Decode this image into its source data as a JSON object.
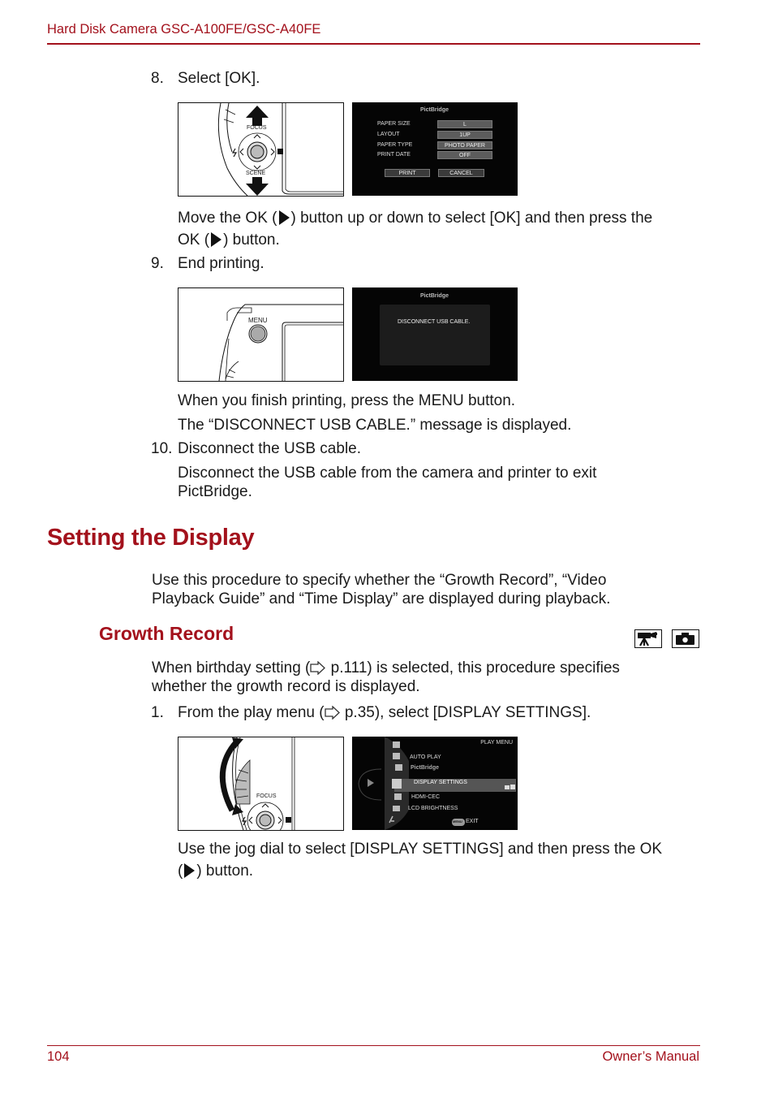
{
  "header": {
    "title": "Hard Disk Camera GSC-A100FE/GSC-A40FE",
    "accent_color": "#a3111c"
  },
  "steps": {
    "step8": {
      "number": "8.",
      "text": "Select [OK].",
      "desc_part1": "Move the OK (",
      "desc_part2": ") button up or down to select [OK] and then press the",
      "desc_part3": "OK (",
      "desc_part4": ") button."
    },
    "step9": {
      "number": "9.",
      "text": "End printing.",
      "desc1": "When you finish printing, press the MENU button.",
      "desc2": "The “DISCONNECT USB CABLE.” message is displayed."
    },
    "step10": {
      "number": "10.",
      "text": "Disconnect the USB cable.",
      "desc_line1": "Disconnect the USB cable from the camera and printer to exit",
      "desc_line2": "PictBridge."
    },
    "step1": {
      "number": "1.",
      "text_part1": "From the play menu (",
      "text_part2": " p.35), select [DISPLAY SETTINGS].",
      "desc_part1": "Use the jog dial to select [DISPLAY SETTINGS] and then press the OK",
      "desc_part2": "(",
      "desc_part3": ") button."
    }
  },
  "figures": {
    "fig1_camera": {
      "label_focus": "FOCUS",
      "label_scene": "SCENE"
    },
    "fig1_screen": {
      "title": "PictBridge",
      "rows": [
        {
          "label": "PAPER SIZE",
          "value": "L"
        },
        {
          "label": "LAYOUT",
          "value": "1UP"
        },
        {
          "label": "PAPER TYPE",
          "value": "PHOTO PAPER"
        },
        {
          "label": "PRINT DATE",
          "value": "OFF"
        }
      ],
      "print_button": "PRINT",
      "cancel_button": "CANCEL"
    },
    "fig2_camera": {
      "label_menu": "MENU"
    },
    "fig2_screen": {
      "title": "PictBridge",
      "message": "DISCONNECT USB CABLE."
    },
    "fig3_camera": {
      "label_focus": "FOCUS"
    },
    "fig3_screen": {
      "header": "PLAY MENU",
      "items": [
        "AUTO PLAY",
        "PictBridge",
        "DISPLAY SETTINGS",
        "HDMI-CEC",
        "LCD BRIGHTNESS"
      ],
      "selected_item": "DISPLAY SETTINGS",
      "menu_badge": "MENU",
      "exit_label": "EXIT"
    }
  },
  "section": {
    "title": "Setting the Display",
    "intro_line1": "Use this procedure to specify whether the “Growth Record”, “Video",
    "intro_line2": "Playback Guide” and “Time Display” are displayed during playback.",
    "subsection": {
      "title": "Growth Record",
      "mode_icons": [
        "video-camera-icon",
        "still-camera-icon"
      ],
      "body_part1": "When birthday setting (",
      "body_part2": " p.111) is selected, this procedure specifies",
      "body_line2": "whether the growth record is displayed."
    }
  },
  "footer": {
    "page_number": "104",
    "manual_title": "Owner’s Manual"
  }
}
